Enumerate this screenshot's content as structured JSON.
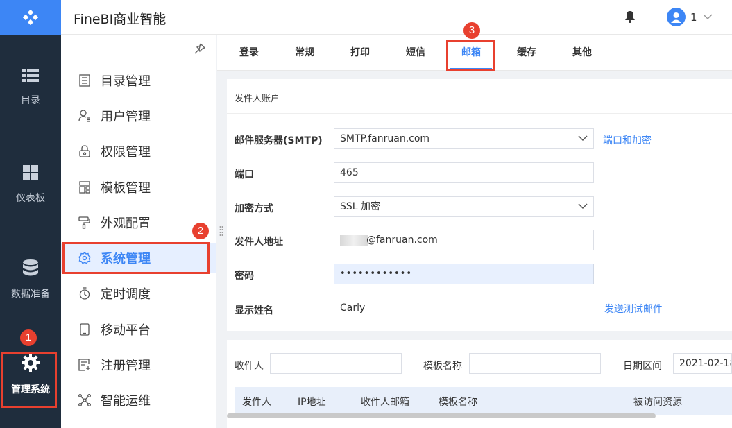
{
  "app": {
    "title": "FineBI商业智能"
  },
  "header": {
    "user_name": "1"
  },
  "rail": {
    "items": [
      {
        "label": "目录",
        "icon": "list-icon"
      },
      {
        "label": "仪表板",
        "icon": "dashboard-icon"
      },
      {
        "label": "数据准备",
        "icon": "database-icon"
      },
      {
        "label": "管理系统",
        "icon": "gear-icon",
        "active": true
      }
    ]
  },
  "submenu": {
    "items": [
      {
        "label": "目录管理",
        "icon": "catalog-icon"
      },
      {
        "label": "用户管理",
        "icon": "user-icon"
      },
      {
        "label": "权限管理",
        "icon": "lock-icon"
      },
      {
        "label": "模板管理",
        "icon": "template-icon"
      },
      {
        "label": "外观配置",
        "icon": "paint-roller-icon"
      },
      {
        "label": "系统管理",
        "icon": "settings-icon",
        "active": true
      },
      {
        "label": "定时调度",
        "icon": "timer-icon"
      },
      {
        "label": "移动平台",
        "icon": "mobile-icon"
      },
      {
        "label": "注册管理",
        "icon": "register-icon"
      },
      {
        "label": "智能运维",
        "icon": "ops-icon"
      }
    ]
  },
  "tabs": [
    {
      "label": "登录"
    },
    {
      "label": "常规"
    },
    {
      "label": "打印"
    },
    {
      "label": "短信"
    },
    {
      "label": "邮箱",
      "active": true
    },
    {
      "label": "缓存"
    },
    {
      "label": "其他"
    }
  ],
  "form": {
    "section_title": "发件人账户",
    "smtp_label": "邮件服务器(SMTP)",
    "smtp_value": "SMTP.fanruan.com",
    "port_encrypt_link": "端口和加密",
    "port_label": "端口",
    "port_value": "465",
    "encryption_label": "加密方式",
    "encryption_value": "SSL 加密",
    "sender_address_label": "发件人地址",
    "sender_address_value": "@fanruan.com",
    "password_label": "密码",
    "password_value": "••••••••••••",
    "display_name_label": "显示姓名",
    "display_name_value": "Carly",
    "send_test_link": "发送测试邮件"
  },
  "log_filters": {
    "recipient_label": "收件人",
    "template_label": "模板名称",
    "date_range_label": "日期区间",
    "date_value": "2021-02-18"
  },
  "log_table": {
    "columns": [
      "发件人",
      "IP地址",
      "收件人邮箱",
      "模板名称",
      "被访问资源"
    ]
  },
  "annotations": [
    "1",
    "2",
    "3"
  ],
  "colors": {
    "accent": "#3d86f5",
    "rail_bg": "#1f2d3d",
    "annotation": "#e8402f"
  }
}
